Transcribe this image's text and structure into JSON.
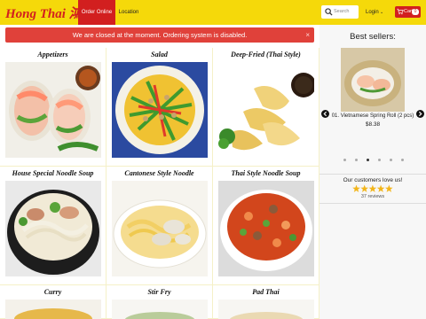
{
  "header": {
    "logo": "Hong Thai 鴻泰",
    "nav": {
      "order_online": "Order Online",
      "location": "Location"
    },
    "search": {
      "placeholder": "Search"
    },
    "login": "Login",
    "cart": {
      "label": "Cart",
      "count": "0"
    },
    "colors": {
      "bar": "#f5d90a",
      "accent": "#d21f1f"
    }
  },
  "alert": {
    "message": "We are closed at the moment. Ordering system is disabled.",
    "close": "×"
  },
  "categories": [
    {
      "title": "Appetizers",
      "icon": "spring-rolls-image"
    },
    {
      "title": "Salad",
      "icon": "mango-salad-image"
    },
    {
      "title": "Deep-Fried (Thai Style)",
      "icon": "tempura-image"
    },
    {
      "title": "House Special Noodle Soup",
      "icon": "noodle-soup-image"
    },
    {
      "title": "Cantonese Style Noodle",
      "icon": "wonton-noodle-image"
    },
    {
      "title": "Thai Style Noodle Soup",
      "icon": "tom-yum-image"
    },
    {
      "title": "Curry",
      "icon": "curry-image"
    },
    {
      "title": "Stir Fry",
      "icon": "stir-fry-image"
    },
    {
      "title": "Pad Thai",
      "icon": "pad-thai-image"
    }
  ],
  "sidebar": {
    "title": "Best sellers:",
    "item": {
      "name": "01. Vietnamese Spring Roll (2 pcs)",
      "price": "$8.38"
    },
    "slide_count": 6,
    "active_slide": 3,
    "love_text": "Our customers love us!",
    "rating": 5,
    "reviews": "37 reviews"
  }
}
